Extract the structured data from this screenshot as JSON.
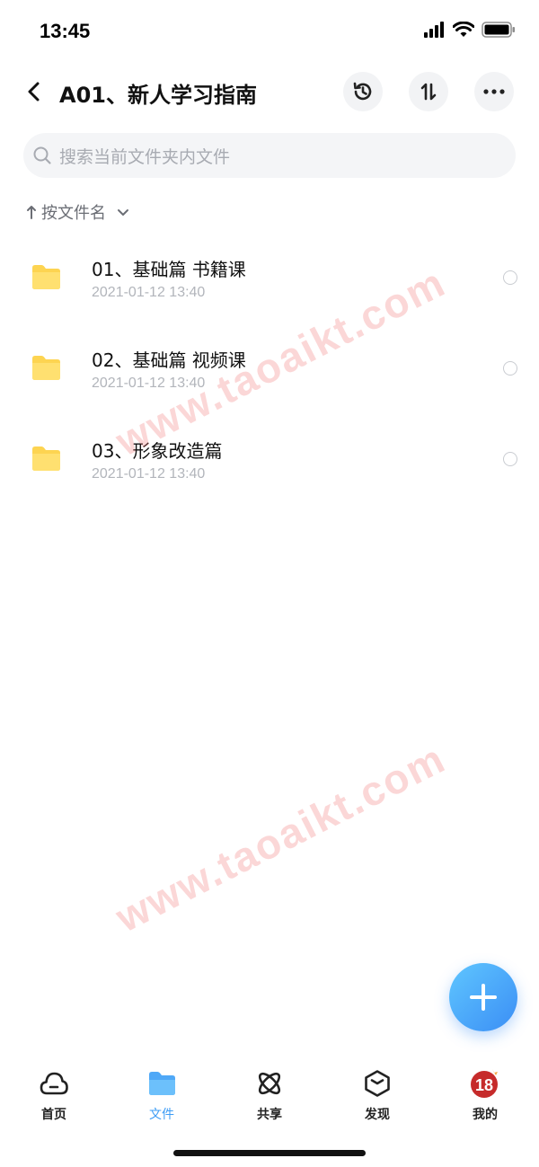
{
  "status_bar": {
    "time": "13:45"
  },
  "nav": {
    "title": "A01、新人学习指南"
  },
  "search": {
    "placeholder": "搜索当前文件夹内文件"
  },
  "sort": {
    "label": "按文件名"
  },
  "files": [
    {
      "name": "01、基础篇  书籍课",
      "date": "2021-01-12 13:40"
    },
    {
      "name": "02、基础篇 视频课",
      "date": "2021-01-12 13:40"
    },
    {
      "name": "03、形象改造篇",
      "date": "2021-01-12 13:40"
    }
  ],
  "watermark": "www.taoaikt.com",
  "tabs": [
    {
      "label": "首页",
      "icon": "cloud-icon"
    },
    {
      "label": "文件",
      "icon": "folder-icon"
    },
    {
      "label": "共享",
      "icon": "atom-icon"
    },
    {
      "label": "发现",
      "icon": "cube-icon"
    },
    {
      "label": "我的",
      "icon": "avatar-icon",
      "badge": "18"
    }
  ],
  "colors": {
    "accent": "#3c9cf5",
    "folder": "#fdd451",
    "watermark": "#f06e6e"
  }
}
